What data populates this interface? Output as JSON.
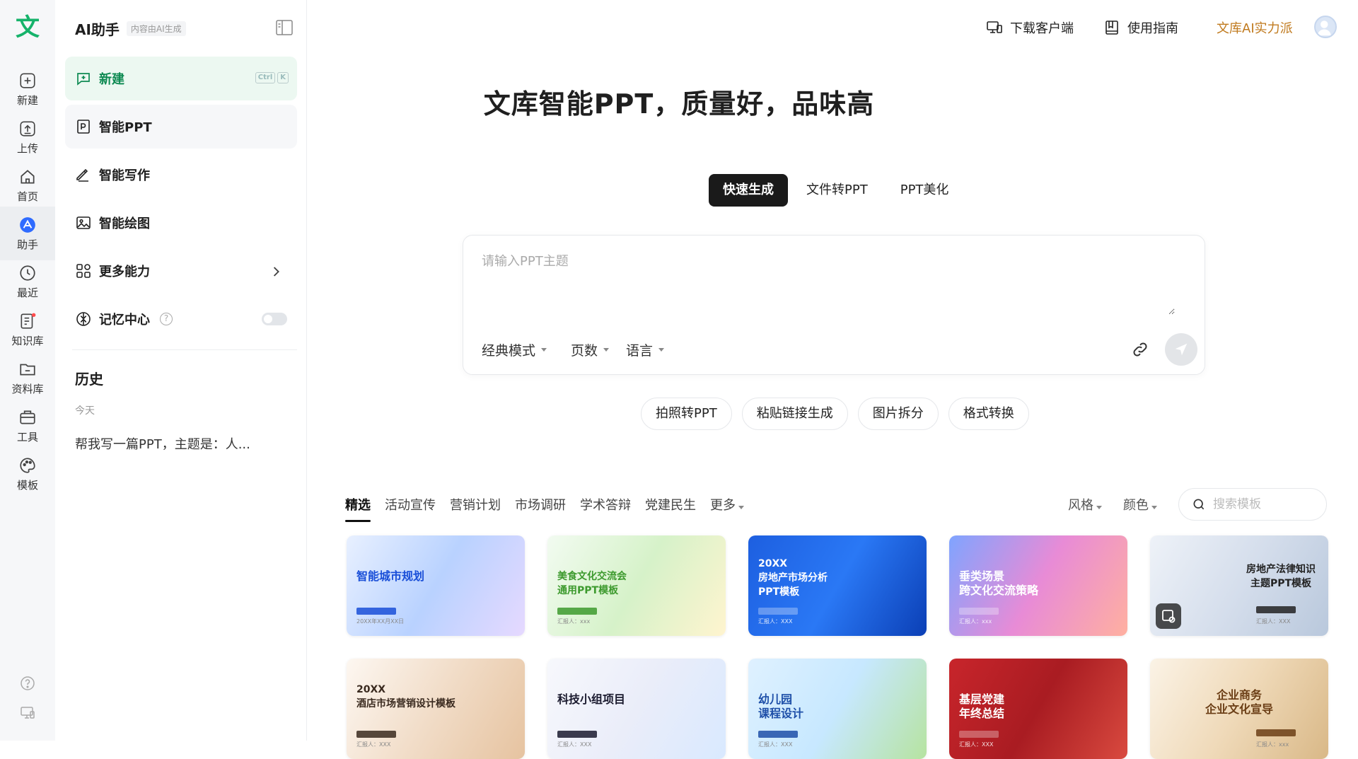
{
  "rail": {
    "logo": "文",
    "items": [
      {
        "label": "新建",
        "icon": "plus-square-icon"
      },
      {
        "label": "上传",
        "icon": "upload-icon"
      },
      {
        "label": "首页",
        "icon": "home-icon"
      },
      {
        "label": "助手",
        "icon": "assistant-icon"
      },
      {
        "label": "最近",
        "icon": "clock-icon"
      },
      {
        "label": "知识库",
        "icon": "knowledge-icon"
      },
      {
        "label": "资料库",
        "icon": "folder-icon"
      },
      {
        "label": "工具",
        "icon": "toolbox-icon"
      },
      {
        "label": "模板",
        "icon": "palette-icon"
      }
    ]
  },
  "panel": {
    "title": "AI助手",
    "tag": "内容由AI生成",
    "new_label": "新建",
    "kbd": [
      "Ctrl",
      "K"
    ],
    "menu": [
      {
        "label": "智能PPT",
        "icon": "ppt-icon"
      },
      {
        "label": "智能写作",
        "icon": "pen-icon"
      },
      {
        "label": "智能绘图",
        "icon": "image-icon"
      },
      {
        "label": "更多能力",
        "icon": "grid-icon"
      },
      {
        "label": "记忆中心",
        "icon": "memory-icon"
      }
    ],
    "history_title": "历史",
    "history_day": "今天",
    "history_items": [
      "帮我写一篇PPT，主题是：人..."
    ]
  },
  "topbar": {
    "download": "下载客户端",
    "guide": "使用指南",
    "promo": "文库AI实力派",
    "promo_color": "#c07a1e"
  },
  "hero": {
    "title": "文库智能PPT，质量好，品味高"
  },
  "mode_tabs": [
    "快速生成",
    "文件转PPT",
    "PPT美化"
  ],
  "prompt": {
    "placeholder": "请输入PPT主题",
    "options": [
      "经典模式",
      "页数",
      "语言"
    ]
  },
  "chips": [
    "拍照转PPT",
    "粘贴链接生成",
    "图片拆分",
    "格式转换"
  ],
  "categories": [
    "精选",
    "活动宣传",
    "营销计划",
    "市场调研",
    "学术答辩",
    "党建民生",
    "更多"
  ],
  "filters": [
    "风格",
    "颜色"
  ],
  "search": {
    "placeholder": "搜索模板"
  },
  "templates": [
    {
      "title": "智能城市规划",
      "sub": "20XX年XX月XX日",
      "colors": [
        "#e8f0ff",
        "#b9d2ff",
        "#e6d9ff"
      ],
      "text_color": "#1a4fd8"
    },
    {
      "title": "美食文化交流会\n通用PPT模板",
      "sub": "汇报人：xxx",
      "colors": [
        "#f2fbf1",
        "#d6f2c9",
        "#fff4cf"
      ],
      "text_color": "#3d9a2e"
    },
    {
      "title": "20XX\n房地产市场分析\nPPT模板",
      "sub": "汇报人：XXX",
      "colors": [
        "#1d5fe0",
        "#2a78f5",
        "#0b3fb5"
      ],
      "text_color": "#ffffff"
    },
    {
      "title": "垂类场景\n跨文化交流策略",
      "sub": "汇报人：xxx",
      "colors": [
        "#7fa4ff",
        "#e88bd6",
        "#ffb0a0"
      ],
      "text_color": "#ffffff"
    },
    {
      "title": "房地产法律知识\n主题PPT模板",
      "sub": "汇报人：XXX",
      "colors": [
        "#eef2f8",
        "#d5deec",
        "#b9c8dc"
      ],
      "text_color": "#222222"
    },
    {
      "title": "20XX\n酒店市场营销设计模板",
      "sub": "汇报人：XXX",
      "colors": [
        "#fdf7f1",
        "#f1dcc7",
        "#e6c3a0"
      ],
      "text_color": "#3a2a1f"
    },
    {
      "title": "科技小组项目",
      "sub": "汇报人：XXX",
      "colors": [
        "#f7f8fc",
        "#eaedf9",
        "#d9e9ff"
      ],
      "text_color": "#1a1a2e"
    },
    {
      "title": "幼儿园\n课程设计",
      "sub": "汇报人：XXX",
      "colors": [
        "#dff1ff",
        "#c7e8ff",
        "#b6e3a0"
      ],
      "text_color": "#1e4fa8"
    },
    {
      "title": "基层党建\n年终总结",
      "sub": "汇报人：XXX",
      "colors": [
        "#c8252b",
        "#a91c22",
        "#d94a3f"
      ],
      "text_color": "#ffffff"
    },
    {
      "title": "企业商务\n企业文化宣导",
      "sub": "汇报人：xxx",
      "colors": [
        "#fbf3e6",
        "#efd9b8",
        "#d9b887"
      ],
      "text_color": "#6b3e16"
    }
  ]
}
